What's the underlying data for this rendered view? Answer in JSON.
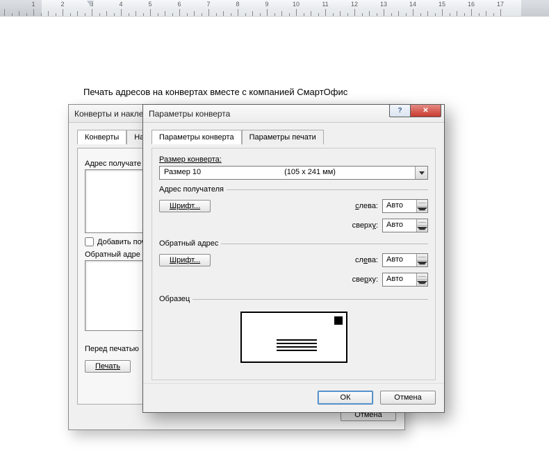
{
  "ruler": {
    "min_cm": 0,
    "max_cm": 17,
    "labels": [
      1,
      2,
      3,
      4,
      5,
      6,
      7,
      8,
      9,
      10,
      11,
      12,
      13,
      14,
      15,
      16,
      17
    ]
  },
  "document": {
    "heading": "Печать адресов на конвертах вместе с компанией СмартОфис"
  },
  "back_dialog": {
    "title": "Конверты и накле",
    "tabs": {
      "tab1": "Конверты",
      "tab2": "Нак"
    },
    "recipient_label": "Адрес получате",
    "add_postage": "Добавить поч",
    "return_label": "Обратный адре",
    "before_print": "Перед печатью",
    "print_btn": "Печать",
    "cancel_btn": "Отмена"
  },
  "front_dialog": {
    "title": "Параметры конверта",
    "tabs": {
      "tab1": "Параметры конверта",
      "tab2": "Параметры  печати"
    },
    "size_label": "Размер конверта:",
    "size_name": "Размер 10",
    "size_dim": "(105 x 241 мм)",
    "recipient_group": "Адрес получателя",
    "return_group": "Обратный адрес",
    "font_btn": "Шрифт...",
    "left_label": "слева:",
    "top_label": "сверху:",
    "left_value": "Авто",
    "top_value": "Авто",
    "sample_label": "Образец",
    "ok_btn": "ОК",
    "cancel_btn": "Отмена"
  }
}
